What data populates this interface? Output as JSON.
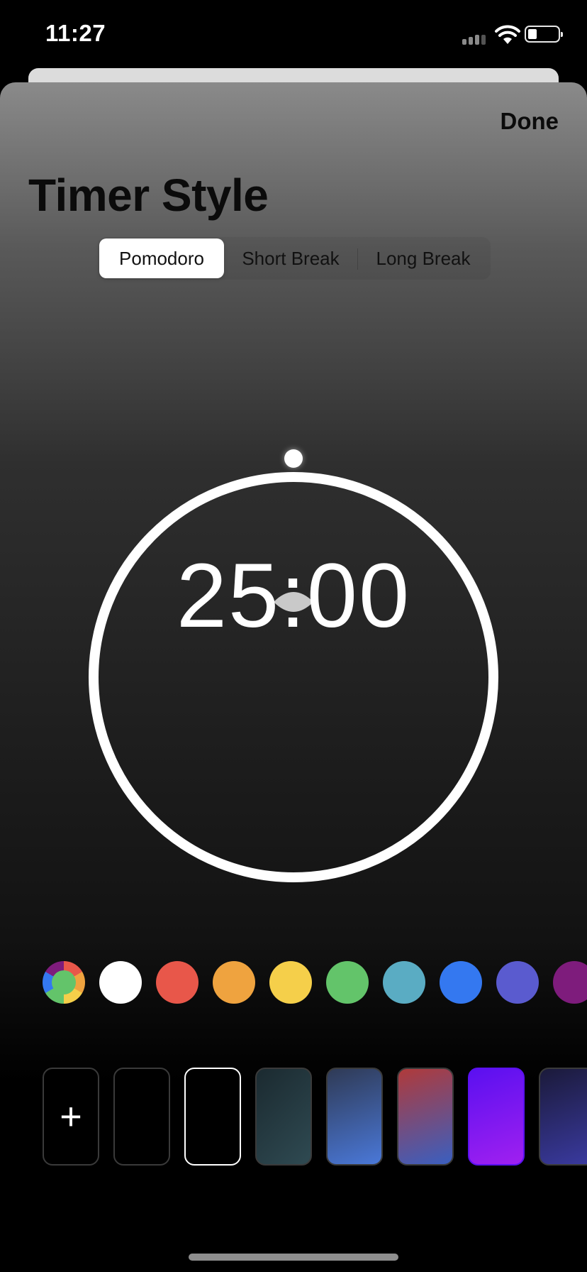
{
  "status_bar": {
    "time": "11:27"
  },
  "sheet": {
    "done_label": "Done",
    "title": "Timer Style"
  },
  "segments": [
    {
      "label": "Pomodoro",
      "selected": true
    },
    {
      "label": "Short Break",
      "selected": false
    },
    {
      "label": "Long Break",
      "selected": false
    }
  ],
  "timer": {
    "display": "25:00",
    "ring_color": "#FFFFFF",
    "progress": 1.0
  },
  "color_swatches": [
    {
      "name": "multicolor",
      "color": "conic"
    },
    {
      "name": "white",
      "color": "#FFFFFF"
    },
    {
      "name": "red",
      "color": "#E8574A"
    },
    {
      "name": "orange",
      "color": "#EFA33F"
    },
    {
      "name": "yellow",
      "color": "#F5CF4A"
    },
    {
      "name": "green",
      "color": "#63C46A"
    },
    {
      "name": "teal",
      "color": "#5AACC3"
    },
    {
      "name": "blue",
      "color": "#3478F0"
    },
    {
      "name": "indigo",
      "color": "#5A5BCF"
    },
    {
      "name": "purple",
      "color": "#7E1C7C"
    }
  ],
  "background_tiles": [
    {
      "name": "add",
      "label": "+"
    },
    {
      "name": "black",
      "style": "#000000"
    },
    {
      "name": "black-selected",
      "style": "#000000",
      "selected": true
    },
    {
      "name": "dark-teal",
      "style": "linear-gradient(135deg,#1b2a30,#2f4a52)"
    },
    {
      "name": "slate-blue",
      "style": "linear-gradient(160deg,#2f3a55,#4a78d8)"
    },
    {
      "name": "red-blue",
      "style": "linear-gradient(160deg,#b03a3a,#3a5fc0)"
    },
    {
      "name": "violet",
      "style": "linear-gradient(160deg,#5a10f0,#a020f0)"
    },
    {
      "name": "navy",
      "style": "linear-gradient(160deg,#1b1a3a,#3a3aa0)"
    }
  ]
}
